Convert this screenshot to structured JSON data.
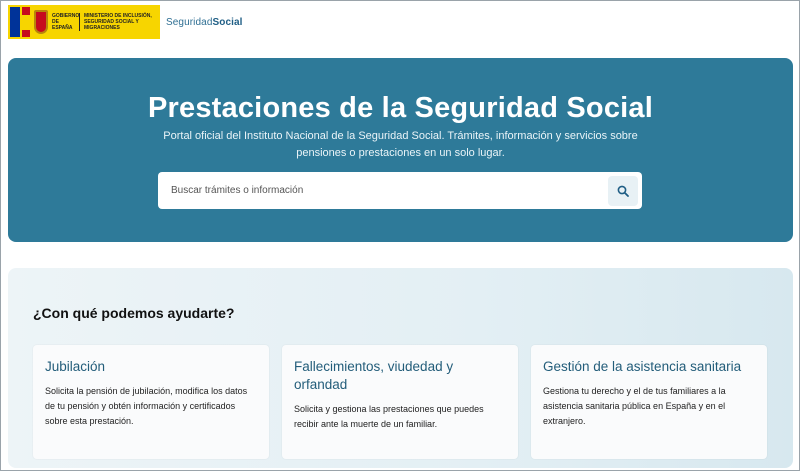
{
  "header": {
    "gov_line1": "GOBIERNO DE ESPAÑA",
    "gov_line2": "MINISTERIO DE INCLUSIÓN, SEGURIDAD SOCIAL Y MIGRACIONES",
    "ss_logo_light": "Seguridad",
    "ss_logo_bold": "Social"
  },
  "hero": {
    "title": "Prestaciones de la Seguridad Social",
    "subtitle": "Portal oficial del Instituto Nacional de la Seguridad Social. Trámites, información y servicios sobre pensiones o prestaciones en un solo lugar.",
    "search_placeholder": "Buscar trámites o información",
    "search_icon": "search-icon"
  },
  "help": {
    "title": "¿Con qué podemos ayudarte?",
    "cards": [
      {
        "title": "Jubilación",
        "description": "Solicita la pensión de jubilación, modifica los datos de tu pensión y obtén información y certificados sobre esta prestación."
      },
      {
        "title": "Fallecimientos, viudedad y orfandad",
        "description": "Solicita y gestiona las prestaciones que puedes recibir ante la muerte de un familiar."
      },
      {
        "title": "Gestión de la asistencia sanitaria",
        "description": "Gestiona tu derecho y el de tus familiares a la asistencia sanitaria pública en España y en el extranjero."
      }
    ]
  },
  "colors": {
    "hero_bg": "#2e7a99",
    "card_title": "#235d7a",
    "gov_yellow": "#f7d500"
  }
}
